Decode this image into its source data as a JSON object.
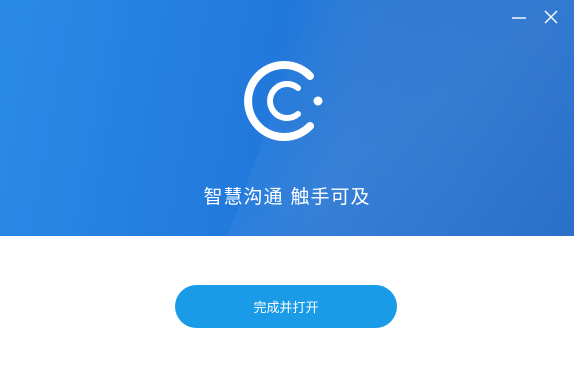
{
  "window": {
    "controls": {
      "minimize_icon": "minimize-icon",
      "close_icon": "close-icon"
    }
  },
  "banner": {
    "logo_icon": "app-logo-icon",
    "slogan": "智慧沟通 触手可及",
    "colors": {
      "primary": "#2179dc",
      "secondary": "#2a8be6"
    }
  },
  "footer": {
    "finish_button_label": "完成并打开",
    "button_color": "#1a9be8"
  }
}
